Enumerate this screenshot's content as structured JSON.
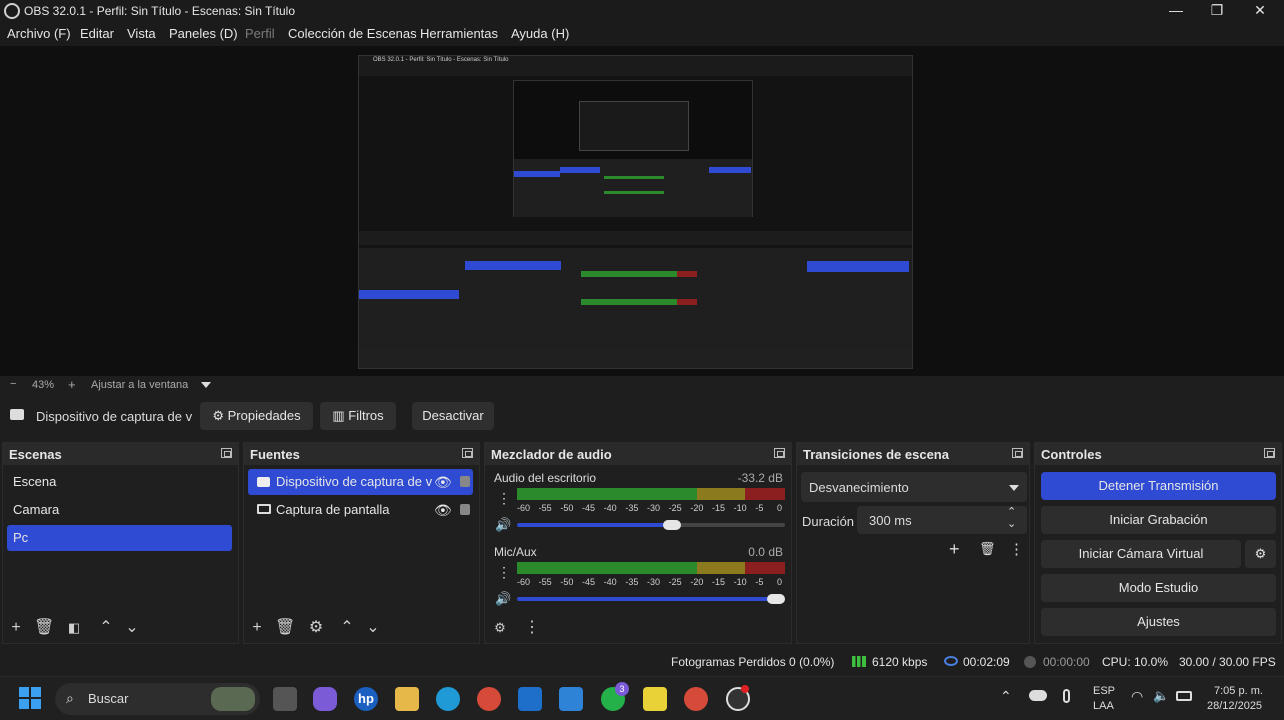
{
  "window": {
    "title": "OBS 32.0.1 - Perfil: Sin Título - Escenas: Sin Título",
    "minimize": "—",
    "maximize": "❐",
    "close": "✕"
  },
  "menu": [
    {
      "label": "Archivo (F)",
      "enabled": true
    },
    {
      "label": "Editar",
      "enabled": true
    },
    {
      "label": "Vista",
      "enabled": true
    },
    {
      "label": "Paneles (D)",
      "enabled": true
    },
    {
      "label": "Perfil",
      "enabled": false
    },
    {
      "label": "Colección de Escenas",
      "enabled": true
    },
    {
      "label": "Herramientas",
      "enabled": true
    },
    {
      "label": "Ayuda (H)",
      "enabled": true
    }
  ],
  "preview": {
    "nested_title": "OBS 32.0.1 - Perfil: Sin Título - Escenas: Sin Título"
  },
  "zoom": {
    "minus": "−",
    "value": "43%",
    "plus": "+",
    "fit_label": "Ajustar a la ventana"
  },
  "source_toolbar": {
    "source_name": "Dispositivo de captura de v",
    "properties": "Propiedades",
    "filters": "Filtros",
    "deactivate": "Desactivar"
  },
  "scenes": {
    "title": "Escenas",
    "items": [
      {
        "label": "Escena",
        "selected": false
      },
      {
        "label": "Camara",
        "selected": false
      },
      {
        "label": "Pc",
        "selected": true
      }
    ]
  },
  "sources": {
    "title": "Fuentes",
    "items": [
      {
        "label": "Dispositivo de captura de v",
        "icon": "camera-icon",
        "selected": true
      },
      {
        "label": "Captura de pantalla",
        "icon": "monitor-icon",
        "selected": false
      }
    ]
  },
  "mixer": {
    "title": "Mezclador de audio",
    "tick_labels": [
      "-60",
      "-55",
      "-50",
      "-45",
      "-40",
      "-35",
      "-30",
      "-25",
      "-20",
      "-15",
      "-10",
      "-5",
      "0"
    ],
    "channels": [
      {
        "name": "Audio del escritorio",
        "db": "-33.2 dB",
        "volume": 0.58
      },
      {
        "name": "Mic/Aux",
        "db": "0.0 dB",
        "volume": 1.0
      }
    ]
  },
  "transitions": {
    "title": "Transiciones de escena",
    "selected": "Desvanecimiento",
    "duration_label": "Duración",
    "duration_value": "300 ms"
  },
  "controls": {
    "title": "Controles",
    "stop_stream": "Detener Transmisión",
    "start_recording": "Iniciar Grabación",
    "start_virtual_cam": "Iniciar Cámara Virtual",
    "studio_mode": "Modo Estudio",
    "settings": "Ajustes"
  },
  "status": {
    "dropped_frames": "Fotogramas Perdidos 0 (0.0%)",
    "bitrate": "6120 kbps",
    "stream_time": "00:02:09",
    "record_time": "00:00:00",
    "cpu": "CPU: 10.0%",
    "fps": "30.00 / 30.00 FPS"
  },
  "taskbar": {
    "search_label": "Buscar",
    "whatsapp_badge": "3",
    "lang_line1": "ESP",
    "lang_line2": "LAA",
    "time": "7:05 p. m.",
    "date": "28/12/2025"
  },
  "colors": {
    "accent": "#2f4ad3",
    "meter_green": "#2b8a2b",
    "meter_yellow": "#8b7a1e",
    "meter_red": "#8b1f1f"
  }
}
